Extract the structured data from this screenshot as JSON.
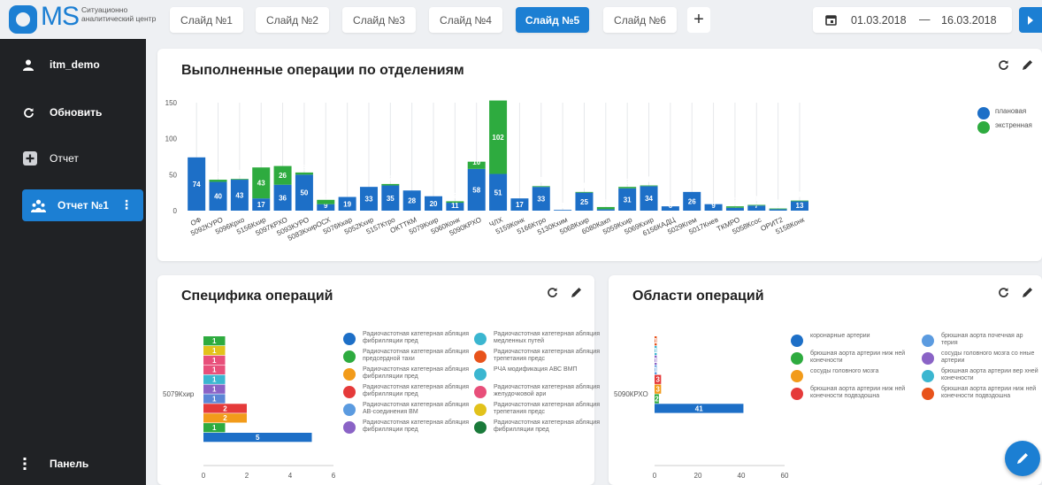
{
  "app": {
    "logo_text": "MS",
    "logo_caption": "Ситуационно аналитический центр"
  },
  "tabs": [
    {
      "label": "Слайд №1"
    },
    {
      "label": "Слайд №2"
    },
    {
      "label": "Слайд №3"
    },
    {
      "label": "Слайд №4"
    },
    {
      "label": "Слайд №5",
      "active": true
    },
    {
      "label": "Слайд №6"
    }
  ],
  "add_tab_label": "+",
  "date_range": {
    "from": "01.03.2018",
    "dash": "—",
    "to": "16.03.2018"
  },
  "sidebar": {
    "user": "itm_demo",
    "refresh": "Обновить",
    "report": "Отчет",
    "active_report": "Отчет №1",
    "kebab": "⋮",
    "panel": "Панель"
  },
  "colors": {
    "accent": "#1c7fd3",
    "planned": "#1d6fc7",
    "emergency": "#2eab3f",
    "sidebar_bg": "#202225"
  },
  "cards": {
    "ops": {
      "title": "Выполненные операции по отделениям"
    },
    "spec": {
      "title": "Специфика операций"
    },
    "areas": {
      "title": "Области операций"
    }
  },
  "chart_data": [
    {
      "type": "bar",
      "stacked": true,
      "title": "Выполненные операции по отделениям",
      "ylim": [
        0,
        150
      ],
      "yticks": [
        0,
        50,
        100,
        150
      ],
      "legend_position": "right",
      "categories": [
        "ОФ",
        "5092КУРО",
        "5096Крхо",
        "5156Кхир",
        "5097КРХО",
        "5093КУРО",
        "5083КхирОСХ",
        "5076Ккар",
        "5052Кхир",
        "5157Ктро",
        "ОКТТКМ",
        "5079Кхир",
        "5060Конк",
        "5090КРХО",
        "ЧЛХ",
        "5159Конк",
        "5166Ктро",
        "5130Кхим",
        "5068Кхир",
        "6080Какп",
        "5059Кхир",
        "5069Кхир",
        "6156КАДЦ",
        "5029Кгем",
        "5017Кнев",
        "ТКМРО",
        "5058Ксос",
        "ОРИТ2",
        "5158Конк"
      ],
      "series": [
        {
          "name": "плановая",
          "values": [
            74,
            40,
            43,
            17,
            36,
            50,
            9,
            19,
            33,
            35,
            28,
            20,
            11,
            58,
            51,
            17,
            33,
            1,
            25,
            2,
            31,
            34,
            6,
            26,
            9,
            4,
            7,
            2,
            13
          ]
        },
        {
          "name": "экстренная",
          "values": [
            0,
            3,
            1,
            43,
            26,
            3,
            6,
            0,
            0,
            2,
            0,
            0,
            2,
            10,
            102,
            0,
            1,
            0,
            1,
            3,
            2,
            1,
            0,
            0,
            0,
            2,
            1,
            1,
            1
          ]
        }
      ]
    },
    {
      "type": "bar",
      "orientation": "horizontal",
      "stacked": true,
      "title": "Специфика операций",
      "categories": [
        "5079Кхир"
      ],
      "xlim": [
        0,
        6
      ],
      "xticks": [
        0,
        2,
        4,
        6
      ],
      "segment_values": [
        5,
        1,
        2,
        2,
        1,
        1,
        1,
        1,
        1,
        1,
        1
      ],
      "segment_colors": [
        "#1d6fc7",
        "#2eab3f",
        "#f29b1a",
        "#e53a3a",
        "#5b86d6",
        "#8a63c6",
        "#3bb6d0",
        "#e84f7a",
        "#e84f7a",
        "#e2c21b",
        "#2eab3f"
      ],
      "legend": [
        {
          "label": "Радиочастотная катетерная абляция фибрилляции пред",
          "color": "#1d6fc7"
        },
        {
          "label": "Радиочастотная катетерная абляция медленных путей",
          "color": "#3bb6d0"
        },
        {
          "label": "Радиочастотная катетерная абляция предсердной тахи",
          "color": "#2eab3f"
        },
        {
          "label": "Радиочастотная катетерная абляция трепетания предс",
          "color": "#e8531b"
        },
        {
          "label": "Радиочастотная катетерная абляция фибрилляции пред",
          "color": "#f29b1a"
        },
        {
          "label": "РЧА модификация АВС ВМП",
          "color": "#3bb6d0"
        },
        {
          "label": "Радиочастотная катетерная абляция фибрилляции пред",
          "color": "#e53a3a"
        },
        {
          "label": "Радиочастотная катетерная абляция желудочковой ари",
          "color": "#e84f7a"
        },
        {
          "label": "Радиочастотная катетерная абляция АВ-соединения ВМ",
          "color": "#5b9be0"
        },
        {
          "label": "Радиочастотная катетерная абляция трепетания предс",
          "color": "#e2c21b"
        },
        {
          "label": "Радиочастотная катетерная абляция фибрилляции пред",
          "color": "#8a63c6"
        },
        {
          "label": "Радиочастотная катетерная абляция фибрилляции пред",
          "color": "#1a7a3a"
        }
      ]
    },
    {
      "type": "bar",
      "orientation": "horizontal",
      "stacked": true,
      "title": "Области операций",
      "categories": [
        "5090КРХО"
      ],
      "xlim": [
        0,
        60
      ],
      "xticks": [
        0,
        20,
        40,
        60
      ],
      "segment_values": [
        41,
        2,
        3,
        3,
        1,
        1,
        1,
        1
      ],
      "segment_colors": [
        "#1d6fc7",
        "#2eab3f",
        "#f29b1a",
        "#e53a3a",
        "#5b9be0",
        "#8a63c6",
        "#3bb6d0",
        "#e8531b"
      ],
      "legend": [
        {
          "label": "коронарные артерии",
          "color": "#1d6fc7"
        },
        {
          "label": "брюшная аорта почечная ар терия",
          "color": "#5b9be0"
        },
        {
          "label": "брюшная аорта артерии ниж ней конечности",
          "color": "#2eab3f"
        },
        {
          "label": "сосуды головного мозга со нные артерии",
          "color": "#8a63c6"
        },
        {
          "label": "сосуды головного мозга",
          "color": "#f29b1a"
        },
        {
          "label": "брюшная аорта артерии вер хней конечности",
          "color": "#3bb6d0"
        },
        {
          "label": "брюшная аорта артерии ниж ней конечности подвздошна",
          "color": "#e53a3a"
        },
        {
          "label": "брюшная аорта артерии ниж ней конечности подвздошна",
          "color": "#e8531b"
        }
      ]
    }
  ]
}
